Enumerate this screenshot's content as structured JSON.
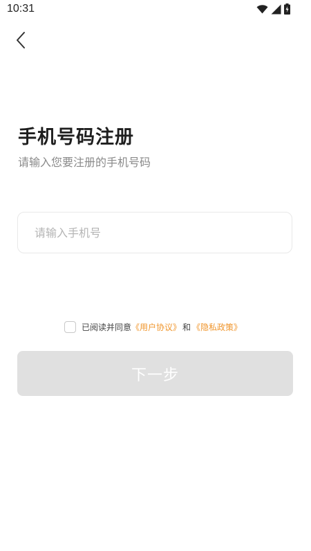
{
  "status_bar": {
    "time": "10:31"
  },
  "header": {
    "back_icon": "chevron-left-icon"
  },
  "page": {
    "title": "手机号码注册",
    "subtitle": "请输入您要注册的手机号码"
  },
  "form": {
    "phone_placeholder": "请输入手机号",
    "phone_value": ""
  },
  "agreement": {
    "checked": false,
    "prefix": "已阅读并同意",
    "user_agreement": "《用户协议》",
    "and": "和",
    "privacy_policy": "《隐私政策》",
    "link_color": "#f0962d"
  },
  "actions": {
    "next_label": "下一步",
    "next_bg": "#e0e0e0"
  }
}
